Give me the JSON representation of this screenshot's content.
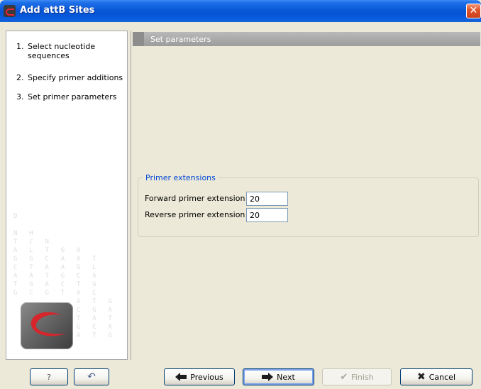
{
  "window": {
    "title": "Add attB Sites",
    "close_glyph": "✕",
    "icon": "app-logo-icon"
  },
  "steps": [
    {
      "num": "1.",
      "label": "Select nucleotide sequences"
    },
    {
      "num": "2.",
      "label": "Specify primer additions"
    },
    {
      "num": "3.",
      "label": "Set primer parameters"
    }
  ],
  "section": {
    "title": "Set parameters"
  },
  "primer_extensions": {
    "legend": "Primer extensions",
    "forward": {
      "label": "Forward primer extension",
      "value": "20"
    },
    "reverse": {
      "label": "Reverse primer extension",
      "value": "20"
    }
  },
  "buttons": {
    "help": "?",
    "restore": "↶",
    "previous": "Previous",
    "next": "Next",
    "finish": "Finish",
    "cancel": "Cancel"
  },
  "colors": {
    "accent": "#0046d5",
    "titlebar": "#0a58d8",
    "close": "#e0562c"
  }
}
